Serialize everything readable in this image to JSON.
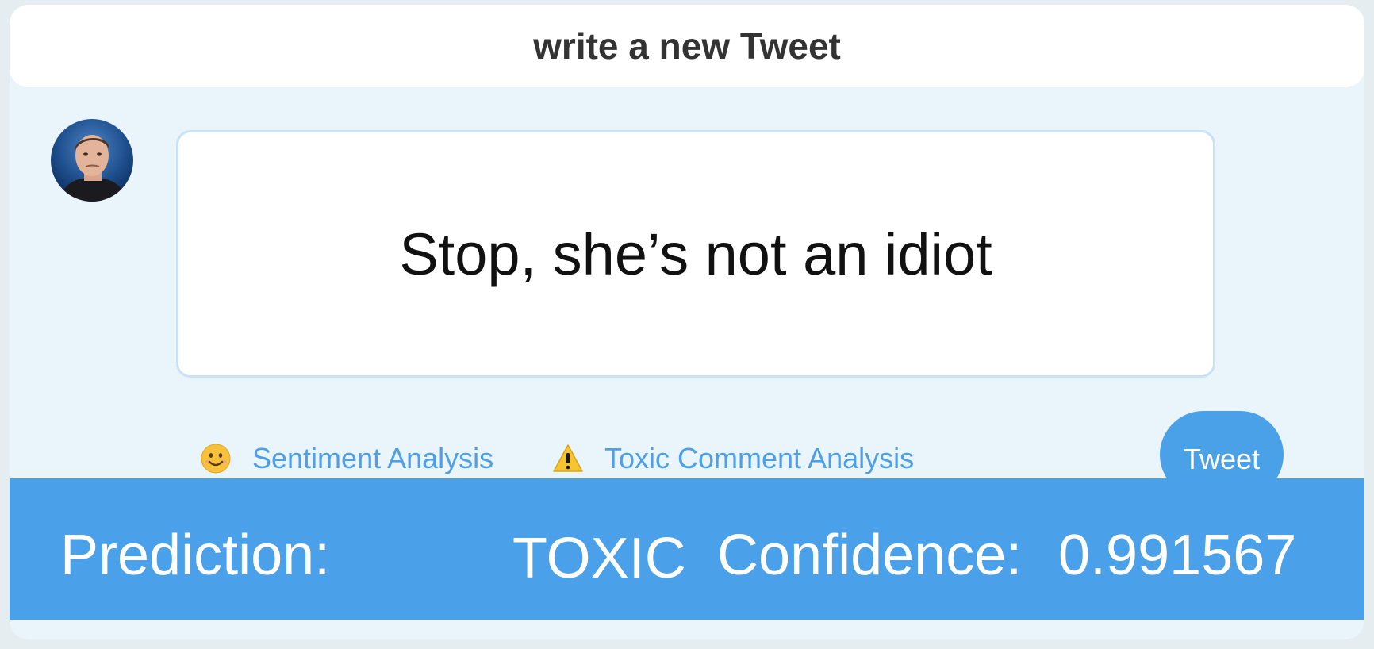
{
  "header": {
    "title": "write a new Tweet"
  },
  "avatar": {
    "icon": "user-avatar-photo"
  },
  "composer": {
    "text": "Stop, she’s not an idiot"
  },
  "actions": [
    {
      "icon": "smiling-face-emoji-icon",
      "label": "Sentiment Analysis"
    },
    {
      "icon": "warning-sign-icon",
      "label": "Toxic Comment Analysis"
    }
  ],
  "tweet_button": {
    "label": "Tweet"
  },
  "result": {
    "prediction_label": "Prediction:",
    "prediction_value": "TOXIC",
    "confidence_label": "Confidence:",
    "confidence_value": "0.991567"
  },
  "colors": {
    "accent": "#4ba1e9",
    "link": "#4da0e8",
    "panel": "#eaf4fb",
    "border": "#c9e2f5"
  }
}
